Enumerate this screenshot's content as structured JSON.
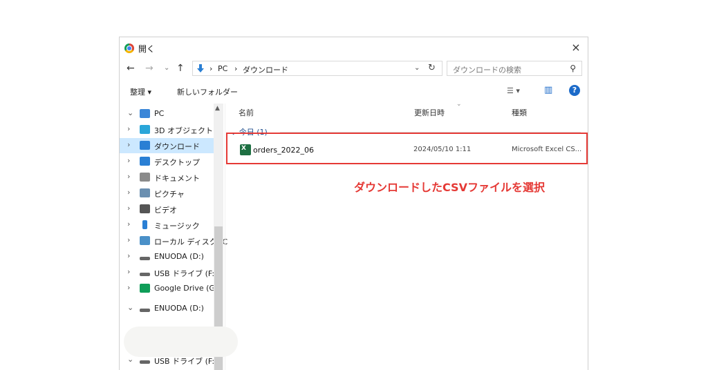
{
  "window": {
    "title": "開く",
    "close": "×"
  },
  "nav": {
    "back": "←",
    "forward": "→",
    "recent": "⌄",
    "up": "↑",
    "breadcrumbs": [
      "PC",
      "ダウンロード"
    ],
    "separator": "›",
    "refresh": "↻",
    "search_placeholder": "ダウンロードの検索",
    "search_icon": "⚲"
  },
  "toolbar": {
    "organize": "整理 ▾",
    "new_folder": "新しいフォルダー",
    "view": "☰ ▾",
    "preview_pane": "▥",
    "help": "?"
  },
  "sidebar": {
    "items": [
      {
        "chevron": "⌄",
        "label": "PC",
        "icon": "pc-icon",
        "color": "#3a86d8"
      },
      {
        "chevron": "›",
        "label": "3D オブジェクト",
        "icon": "cube-icon",
        "color": "#2aa6d9"
      },
      {
        "chevron": "›",
        "label": "ダウンロード",
        "icon": "download-icon",
        "color": "#2a7fd4",
        "selected": true
      },
      {
        "chevron": "›",
        "label": "デスクトップ",
        "icon": "desktop-icon",
        "color": "#2a7fd4"
      },
      {
        "chevron": "›",
        "label": "ドキュメント",
        "icon": "document-icon",
        "color": "#8a8a8a"
      },
      {
        "chevron": "›",
        "label": "ピクチャ",
        "icon": "picture-icon",
        "color": "#6a8fb0"
      },
      {
        "chevron": "›",
        "label": "ビデオ",
        "icon": "video-icon",
        "color": "#555555"
      },
      {
        "chevron": "›",
        "label": "ミュージック",
        "icon": "music-icon",
        "color": "#2a7fd4"
      },
      {
        "chevron": "›",
        "label": "ローカル ディスク (C",
        "icon": "local-disk-icon",
        "color": "#4a90c8"
      },
      {
        "chevron": "›",
        "label": "ENUODA (D:)",
        "icon": "drive-icon",
        "color": "#666666"
      },
      {
        "chevron": "›",
        "label": "USB ドライブ (F:)",
        "icon": "usb-drive-icon",
        "color": "#666666"
      },
      {
        "chevron": "›",
        "label": "Google Drive (G:",
        "icon": "google-drive-icon",
        "color": "#0f9d58"
      },
      {
        "chevron": "⌄",
        "label": "ENUODA (D:)",
        "icon": "drive-icon",
        "color": "#666666"
      },
      {
        "chevron": "⌄",
        "label": "USB ドライブ (F:)",
        "icon": "usb-drive-icon",
        "color": "#666666"
      }
    ]
  },
  "columns": {
    "name": "名前",
    "date": "更新日時",
    "type": "種類",
    "sort_indicator": "⌄"
  },
  "group": {
    "label": "⌄ 今日 (1)"
  },
  "file": {
    "name": "orders_2022_06",
    "date": "2024/05/10 1:11",
    "type": "Microsoft Excel CS..."
  },
  "annotation": {
    "text": "ダウンロードしたCSVファイルを選択",
    "color": "#e53935"
  }
}
